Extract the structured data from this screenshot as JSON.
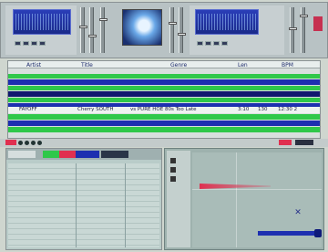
{
  "decks": {
    "left": {
      "display": "",
      "controls": [
        "play-icon",
        "cue-icon",
        "loop-icon",
        "sync-icon"
      ]
    },
    "right": {
      "display": "",
      "controls": [
        "play-icon",
        "cue-icon",
        "loop-icon",
        "sync-icon"
      ]
    }
  },
  "playlist": {
    "columns": [
      "Artist",
      "Title",
      "Genre",
      "Len",
      "BPM"
    ],
    "highlighted_row": {
      "artist": "FAYOFF",
      "title": "Cherry SOUTH",
      "album": "vs PURE HOE",
      "genre": "80s Too Late",
      "time": "3:10",
      "bpm": "130",
      "extra": "12:30 2"
    }
  },
  "colors": {
    "accent_green": "#2fc84a",
    "accent_blue": "#1d2fb0",
    "accent_red": "#e03050",
    "accent_navy": "#10186e"
  },
  "bottom_panel": {
    "browser_rows": 14,
    "marker_icon": "x-marker-icon"
  }
}
